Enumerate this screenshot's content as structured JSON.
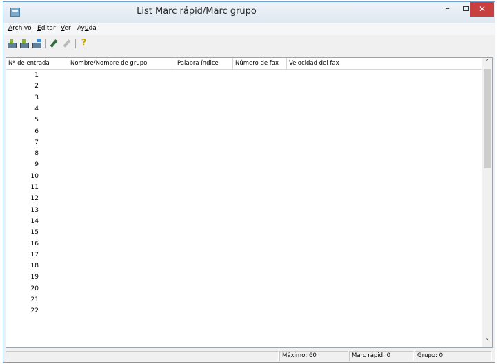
{
  "window": {
    "title": "List Marc rápid/Marc grupo",
    "minimize_glyph": "–",
    "close_glyph": "✕"
  },
  "menu": [
    {
      "accel": "A",
      "rest": "rchivo"
    },
    {
      "accel": "E",
      "rest": "ditar"
    },
    {
      "accel": "V",
      "rest": "er"
    },
    {
      "accel": "Ay",
      "rest": "uda",
      "mid": "u"
    }
  ],
  "menu_text": [
    "Archivo",
    "Editar",
    "Ver",
    "Ayuda"
  ],
  "toolbar": {
    "icons": [
      "add-entry-icon",
      "add-group-icon",
      "import-icon",
      "edit-icon",
      "delete-icon",
      "help-icon"
    ],
    "help_glyph": "?"
  },
  "table": {
    "columns": [
      "Nº de entrada",
      "Nombre/Nombre de grupo",
      "Palabra índice",
      "Número de fax",
      "Velocidad del fax"
    ],
    "rows": [
      "1",
      "2",
      "3",
      "4",
      "5",
      "6",
      "7",
      "8",
      "9",
      "10",
      "11",
      "12",
      "13",
      "14",
      "15",
      "16",
      "17",
      "18",
      "19",
      "20",
      "21",
      "22"
    ]
  },
  "scrollbar": {
    "up_glyph": "˄",
    "down_glyph": "˅"
  },
  "status": {
    "max": "Máximo: 60",
    "speed": "Marc rápid: 0",
    "group": "Grupo: 0"
  },
  "colors": {
    "close_button": "#c7403f",
    "title_bar": "#dfe8f1",
    "window_border": "#6f9fcf"
  }
}
